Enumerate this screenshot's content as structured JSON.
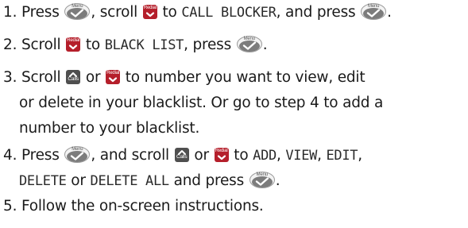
{
  "icons": {
    "menu_button_label": "Menu",
    "redial_key_label": "Redial",
    "calls_key_label": "Calls"
  },
  "steps": [
    {
      "number": "1.",
      "parts": [
        "Press",
        ", scroll",
        "to",
        "CALL BLOCKER",
        ", and press",
        "."
      ]
    },
    {
      "number": "2.",
      "parts": [
        "Scroll",
        "to",
        "BLACK LIST",
        ", press",
        "."
      ]
    },
    {
      "number": "3.",
      "parts": [
        "Scroll",
        "or",
        "to number you want to view, edit",
        "or delete in your blacklist. Or go to step 4 to add a",
        "number to your blacklist."
      ]
    },
    {
      "number": "4.",
      "parts": [
        "Press",
        ", and scroll",
        "or",
        "to",
        "ADD",
        ",",
        "VIEW",
        ",",
        "EDIT",
        ",",
        "DELETE",
        "or",
        "DELETE ALL",
        "and press",
        "."
      ]
    },
    {
      "number": "5.",
      "parts": [
        "Follow the on-screen instructions."
      ]
    }
  ],
  "colors": {
    "redial_key": "#b51f2b",
    "calls_key": "#4f4f4f",
    "text": "#1a1a1a"
  }
}
